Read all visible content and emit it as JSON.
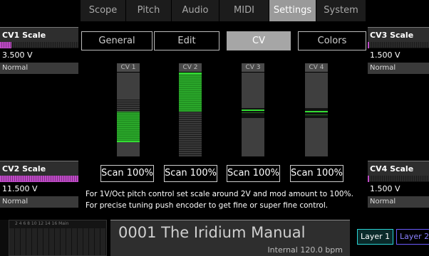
{
  "top_tabs": [
    {
      "label": "Scope"
    },
    {
      "label": "Pitch"
    },
    {
      "label": "Audio"
    },
    {
      "label": "MIDI"
    },
    {
      "label": "Settings"
    },
    {
      "label": "System"
    }
  ],
  "sub_tabs": [
    {
      "label": "General"
    },
    {
      "label": "Edit"
    },
    {
      "label": "CV"
    },
    {
      "label": "Colors"
    }
  ],
  "side_panels": {
    "cv1": {
      "label": "CV1 Scale",
      "value": "3.500 V",
      "mode": "Normal",
      "level": 0.15
    },
    "cv2": {
      "label": "CV2 Scale",
      "value": "11.500 V",
      "mode": "Normal",
      "level": 1.0
    },
    "cv3": {
      "label": "CV3 Scale",
      "value": "1.500 V",
      "mode": "Normal",
      "level": 0.02
    },
    "cv4": {
      "label": "CV4 Scale",
      "value": "1.500 V",
      "mode": "Normal",
      "level": 0.02
    }
  },
  "cv_sliders": [
    {
      "label": "CV 1",
      "scan": "Scan 100%"
    },
    {
      "label": "CV 2",
      "scan": "Scan 100%"
    },
    {
      "label": "CV 3",
      "scan": "Scan 100%"
    },
    {
      "label": "CV 4",
      "scan": "Scan 100%"
    }
  ],
  "help_text": {
    "line1": "For 1V/Oct pitch control set scale around 2V and mod amount to 100%.",
    "line2": "For precise tuning push encoder to get fine or super fine control."
  },
  "grid_numbers": "2  4  6  8  10  12  14  16 Main",
  "preset": {
    "name": "0001 The Iridium Manual",
    "tempo": "Internal 120.0 bpm"
  },
  "layers": [
    {
      "label": "Layer 1"
    },
    {
      "label": "Layer 2"
    }
  ],
  "colors": {
    "accent_magenta": "#c04bc8",
    "cv_green": "#33dd33",
    "layer1": "#2ad4d4",
    "layer2": "#6a5cff"
  }
}
